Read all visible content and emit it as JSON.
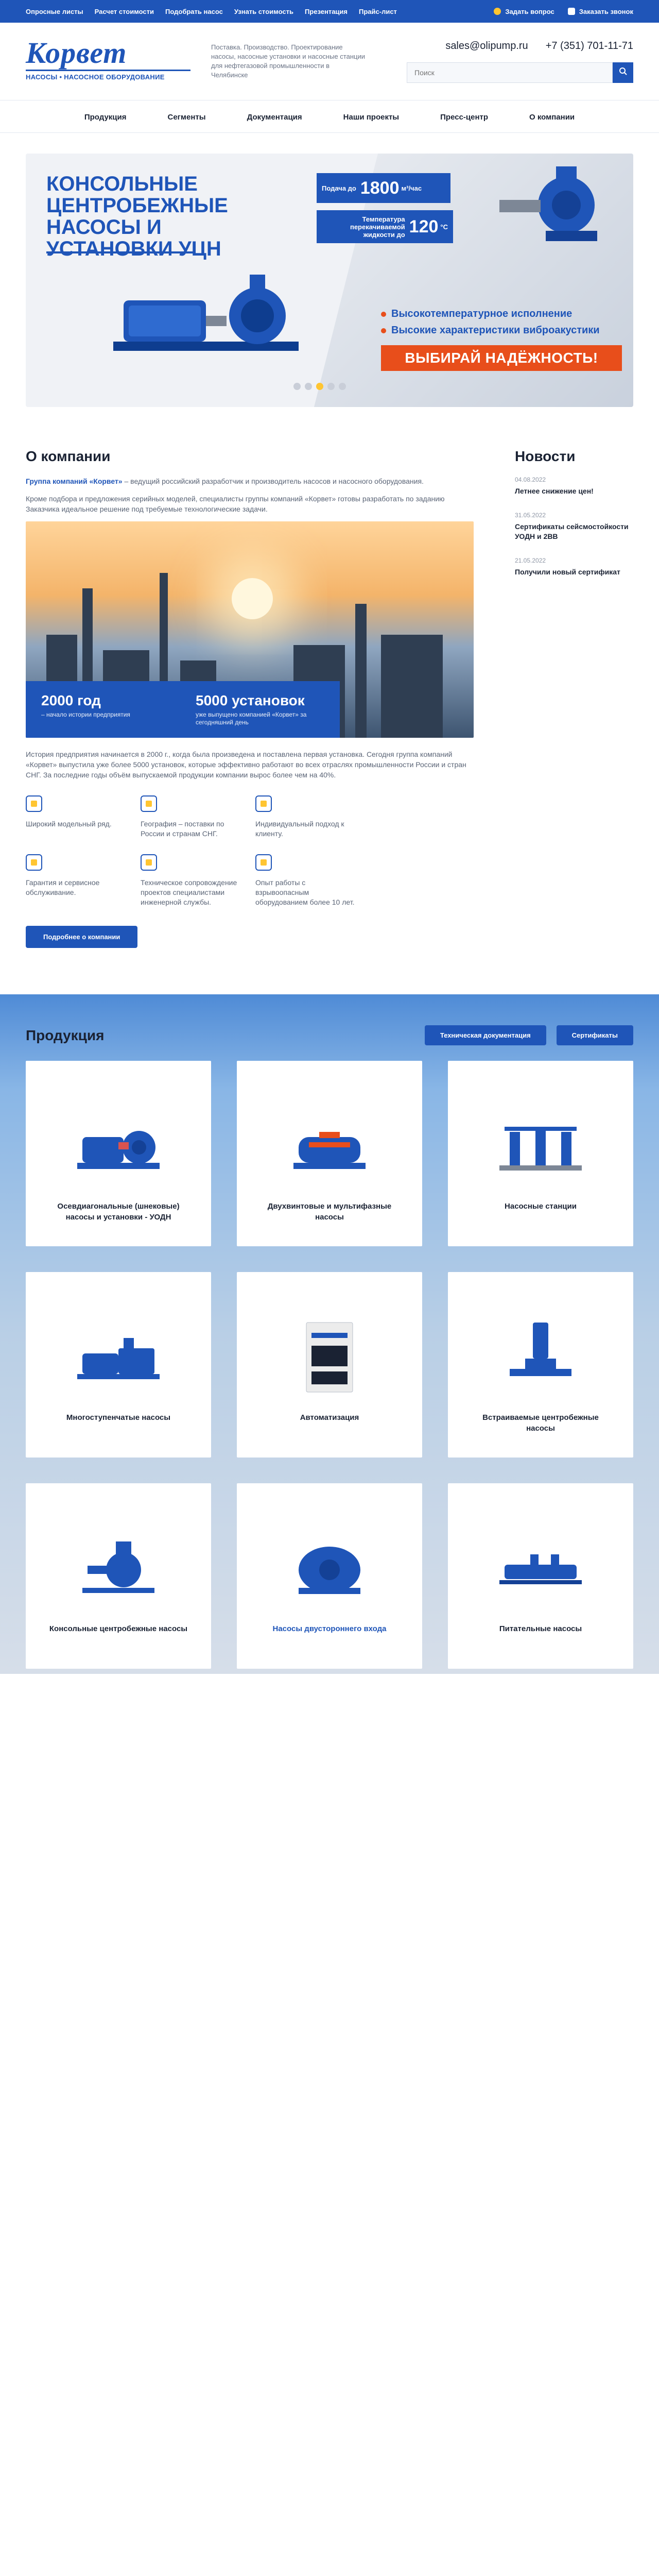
{
  "topbar": {
    "links": [
      "Опросные листы",
      "Расчет стоимости",
      "Подобрать насос",
      "Узнать стоимость",
      "Презентация",
      "Прайс-лист"
    ],
    "ask": "Задать вопрос",
    "callback": "Заказать звонок"
  },
  "header": {
    "logo_main": "Корвет",
    "logo_sub": "НАСОСЫ • НАСОСНОЕ ОБОРУДОВАНИЕ",
    "tagline": "Поставка. Производство. Проектирование насосы, насосные установки и насосные станции для нефтегазовой промышленности в Челябинске",
    "email": "sales@olipump.ru",
    "phone": "+7 (351) 701-11-71",
    "search_placeholder": "Поиск"
  },
  "nav": [
    "Продукция",
    "Сегменты",
    "Документация",
    "Наши проекты",
    "Пресс-центр",
    "О компании"
  ],
  "banner": {
    "title": "Консольные центробежные насосы и установки УЦН",
    "spec1_label": "Подача до",
    "spec1_value": "1800",
    "spec1_unit": "м³/час",
    "spec2_label": "Температура перекачиваемой жидкости до",
    "spec2_value": "120",
    "spec2_unit": "°С",
    "feature1": "Высокотемпературное исполнение",
    "feature2": "Высокие характеристики виброакустики",
    "cta": "ВЫБИРАЙ НАДЁЖНОСТЬ!"
  },
  "about": {
    "title": "О компании",
    "p1_brand": "Группа компаний «Корвет»",
    "p1_rest": " – ведущий российский разработчик и производитель насосов и насосного оборудования.",
    "p2": "Кроме подбора и предложения серийных моделей, специалисты группы компаний «Корвет» готовы разработать по заданию Заказчика идеальное решение под требуемые технологические задачи.",
    "stat1_value": "2000 год",
    "stat1_desc": "– начало истории предприятия",
    "stat2_value": "5000 установок",
    "stat2_desc": "уже выпущено компанией «Корвет» за сегодняшний день",
    "p3": "История предприятия начинается в 2000 г., когда была произведена и поставлена первая установка. Сегодня группа компаний «Корвет» выпустила уже более 5000 установок, которые эффективно работают во всех отраслях промышленности России и стран СНГ. За последние годы объём выпускаемой продукции компании вырос более чем на 40%.",
    "features": [
      "Широкий модельный ряд.",
      "География – поставки по России и странам СНГ.",
      "Индивидуальный подход к клиенту.",
      "",
      "Гарантия и сервисное обслуживание.",
      "Техническое сопровождение проектов специалистами инженерной службы.",
      "Опыт работы с взрывоопасным оборудованием более 10 лет.",
      ""
    ],
    "button": "Подробнее о компании"
  },
  "news": {
    "title": "Новости",
    "items": [
      {
        "date": "04.08.2022",
        "title": "Летнее снижение цен!"
      },
      {
        "date": "31.05.2022",
        "title": "Сертификаты сейсмостойкости УОДН и 2ВВ"
      },
      {
        "date": "21.05.2022",
        "title": "Получили новый сертификат"
      }
    ]
  },
  "products": {
    "title": "Продукция",
    "btn_docs": "Техническая документация",
    "btn_certs": "Сертификаты",
    "items": [
      "Осевдиагональные (шнековые) насосы и установки - УОДН",
      "Двухвинтовые и мультифазные насосы",
      "Насосные станции",
      "Многоступенчатые насосы",
      "Автоматизация",
      "Встраиваемые центробежные насосы",
      "Консольные центробежные насосы",
      "Насосы двустороннего входа",
      "Питательные насосы"
    ]
  },
  "colors": {
    "brand": "#1f55b8",
    "accent": "#ffc531",
    "orange": "#e84e1b"
  }
}
